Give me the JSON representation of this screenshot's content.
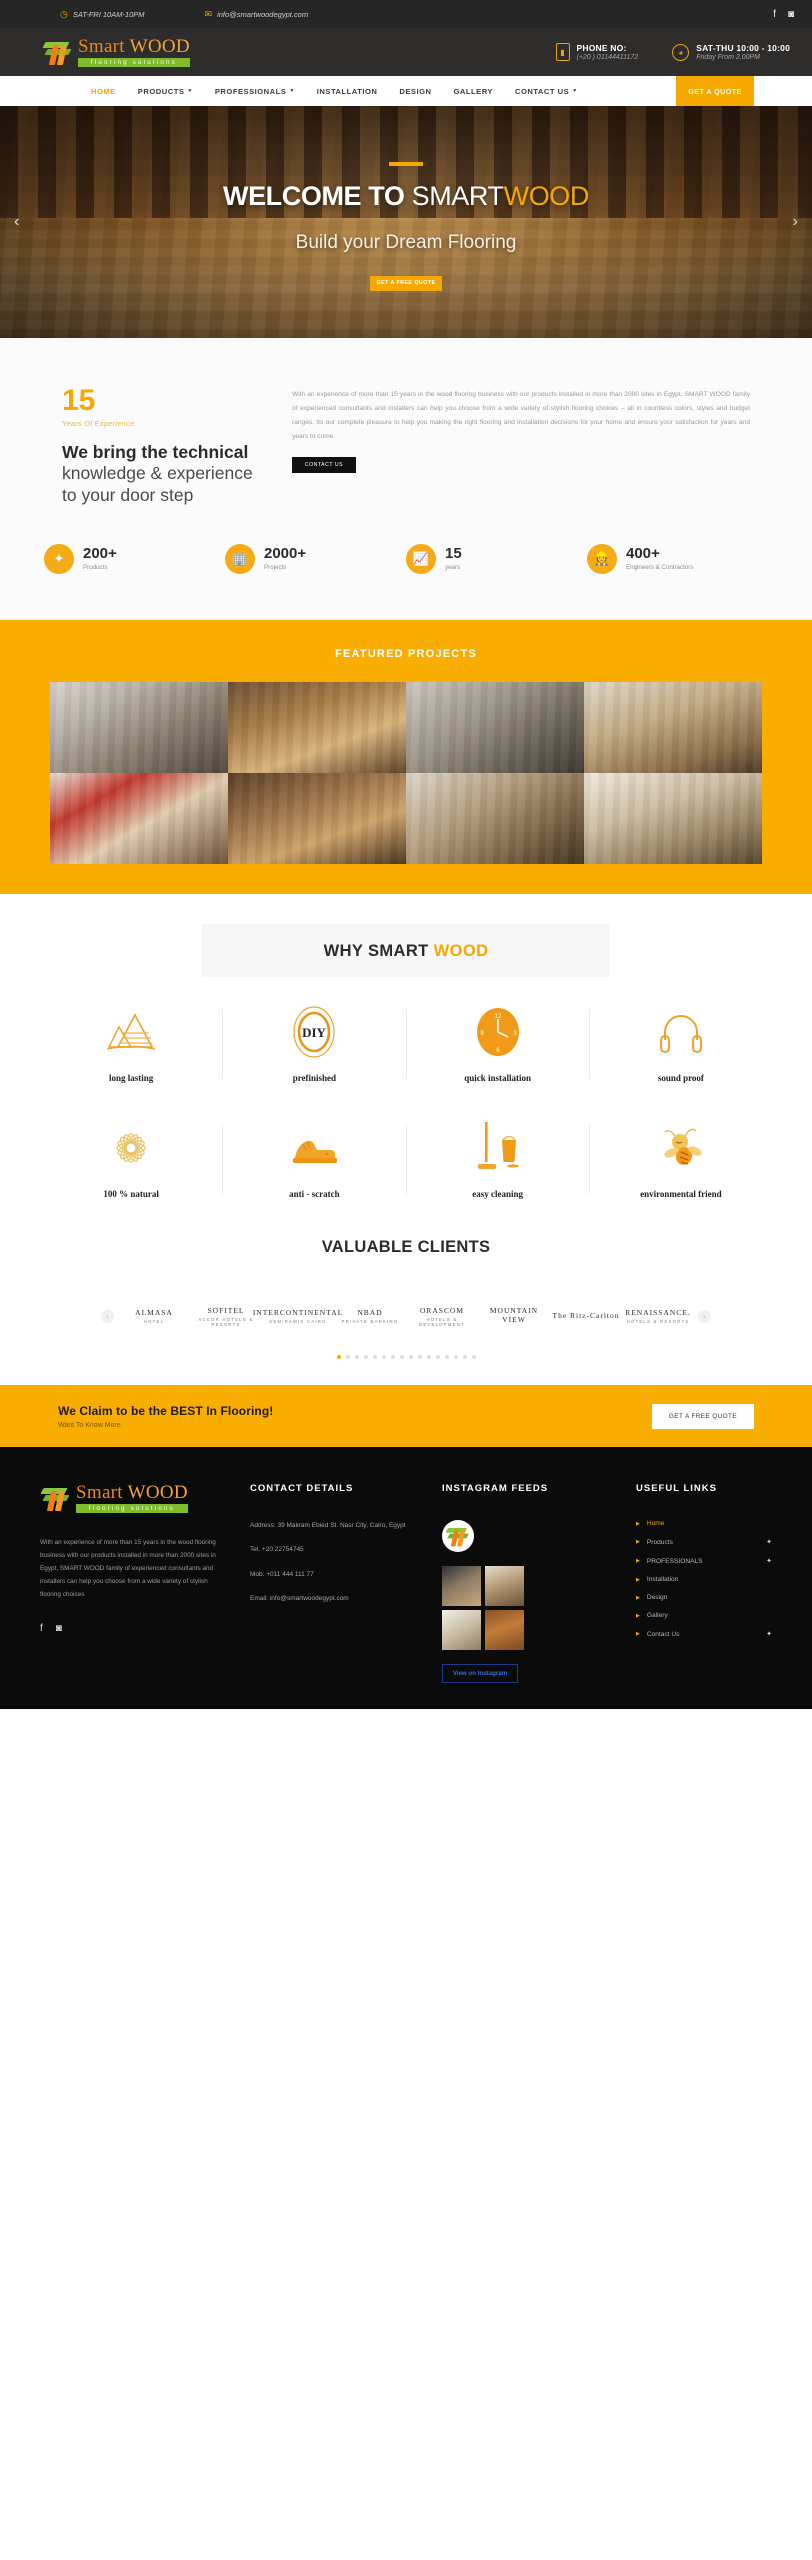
{
  "topbar": {
    "hours": "SAT-FRI 10AM-10PM",
    "email": "info@smartwoodegypt.com",
    "clock_icon": "clock-icon",
    "mail_icon": "mail-icon",
    "facebook_icon": "facebook-icon",
    "instagram_icon": "instagram-icon"
  },
  "header": {
    "logo_name": "Smart ",
    "logo_name_bold": "WOOD",
    "logo_sub": "flooring solutions",
    "phone_label": "PHONE NO:",
    "phone_value": "(+20 ) 01144411172",
    "hours_label": "SAT-THU 10:00 - 10:00",
    "hours_value": "Friday From 2.00PM",
    "phone_icon": "phone-icon",
    "clock_icon": "clock-icon"
  },
  "nav": {
    "items": [
      {
        "label": "HOME",
        "has_caret": false,
        "active": true
      },
      {
        "label": "PRODUCTS",
        "has_caret": true,
        "active": false
      },
      {
        "label": "PROFESSIONALS",
        "has_caret": true,
        "active": false
      },
      {
        "label": "INSTALLATION",
        "has_caret": false,
        "active": false
      },
      {
        "label": "DESIGN",
        "has_caret": false,
        "active": false
      },
      {
        "label": "GALLERY",
        "has_caret": false,
        "active": false
      },
      {
        "label": "CONTACT US",
        "has_caret": true,
        "active": false
      }
    ],
    "cta": "GET A QUOTE"
  },
  "hero": {
    "title_bold": "WELCOME TO ",
    "title_thin": "SMART",
    "title_amber": "WOOD",
    "subtitle": "Build your Dream Flooring",
    "button": "GET A FREE QUOTE",
    "prev_icon": "chevron-left-icon",
    "next_icon": "chevron-right-icon"
  },
  "about": {
    "years_number": "15",
    "years_label": "Years Of Experience",
    "heading_bold": "We bring the technical",
    "heading_light": "knowledge & experience to your door step",
    "paragraph": "With an experience of more than 15 years in the wood flooring business  with our products installed in more than 2000 sites in Egypt, SMART WOOD family of experienced consultants and installers can help you choose from a wide variety of stylish flooring choices – all in countless colors, styles and budget ranges. Its our complete pleasure to help you making the right flooring and installation decisions for your home and ensure your satisfaction for years and years to come.",
    "button": "CONTACT US",
    "stats": [
      {
        "number": "200+",
        "label": "Products",
        "icon": "products-icon",
        "glyph": "❦"
      },
      {
        "number": "2000+",
        "label": "Projects",
        "icon": "building-icon",
        "glyph": "Ἶ2"
      },
      {
        "number": "15",
        "label": "years",
        "icon": "chart-icon",
        "glyph": "◧"
      },
      {
        "number": "400+",
        "label": "Engineers & Contractors",
        "icon": "engineer-icon",
        "glyph": "☺"
      }
    ]
  },
  "featured": {
    "title": "FEATURED PROJECTS",
    "tiles": [
      {
        "name": "project-tile-1"
      },
      {
        "name": "project-tile-2"
      },
      {
        "name": "project-tile-3"
      },
      {
        "name": "project-tile-4"
      },
      {
        "name": "project-tile-5"
      },
      {
        "name": "project-tile-6"
      },
      {
        "name": "project-tile-7"
      },
      {
        "name": "project-tile-8"
      }
    ]
  },
  "why": {
    "title_dark": "WHY SMART ",
    "title_amber": "WOOD",
    "features_row1": [
      {
        "label": "long lasting",
        "icon": "pyramid-icon"
      },
      {
        "label": "prefinished",
        "icon": "diy-icon"
      },
      {
        "label": "quick installation",
        "icon": "clock-icon"
      },
      {
        "label": "sound proof",
        "icon": "headphones-icon"
      }
    ],
    "features_row2": [
      {
        "label": "100 % natural",
        "icon": "flower-icon"
      },
      {
        "label": "anti - scratch",
        "icon": "shoe-icon"
      },
      {
        "label": "easy cleaning",
        "icon": "mop-bucket-icon"
      },
      {
        "label": "environmental friend",
        "icon": "bee-icon"
      }
    ]
  },
  "clients": {
    "title": "VALUABLE CLIENTS",
    "logos": [
      {
        "name": "ALMASA",
        "sub": "HOTEL"
      },
      {
        "name": "SOFITEL",
        "sub": "ACCOR HOTELS & RESORTS"
      },
      {
        "name": "INTERCONTINENTAL",
        "sub": "SEMIRAMIS CAIRO"
      },
      {
        "name": "NBAD",
        "sub": "PRIVATE BANKING"
      },
      {
        "name": "ORASCOM",
        "sub": "HOTELS & DEVELOPMENT"
      },
      {
        "name": "MOUNTAIN VIEW",
        "sub": ""
      },
      {
        "name": "The Ritz-Carlton",
        "sub": ""
      },
      {
        "name": "RENAISSANCE.",
        "sub": "HOTELS & RESORTS"
      }
    ],
    "dots_count": 16,
    "active_dot": 0,
    "prev_icon": "chevron-left-icon",
    "next_icon": "chevron-right-icon"
  },
  "cta": {
    "heading": "We Claim to be the BEST In Flooring!",
    "sub": "Want To Know More.",
    "button": "GET A FREE QUOTE"
  },
  "footer": {
    "logo_name": "Smart ",
    "logo_name_bold": "WOOD",
    "logo_sub": "flooring solutions",
    "about_text": "With an experience of more than 15 years in the wood flooring business with our products installed in more than 2000 sites in Egypt, SMART WOOD family of experienced consultants and installers can help you choose from a wide variety of stylish flooring choices",
    "facebook_icon": "facebook-icon",
    "instagram_icon": "instagram-icon",
    "contact_title": "CONTACT DETAILS",
    "address": "Address: 39 Makram Ebied St. Nasr City, Cairo, Egypt",
    "tel": "Tel. +20 22754745",
    "mob": "Mob. +011 444 111 77",
    "email": "Email: info@smartwoodegypt.com",
    "instagram_title": "INSTAGRAM FEEDS",
    "instagram_button": "View on Instagram",
    "links_title": "USEFUL LINKS",
    "links": [
      {
        "label": "Home",
        "plus": false,
        "active": true
      },
      {
        "label": "Products",
        "plus": true,
        "active": false
      },
      {
        "label": "PROFESSIONALS",
        "plus": true,
        "active": false
      },
      {
        "label": "Installation",
        "plus": false,
        "active": false
      },
      {
        "label": "Design",
        "plus": false,
        "active": false
      },
      {
        "label": "Gallery",
        "plus": false,
        "active": false
      },
      {
        "label": "Contact Us",
        "plus": true,
        "active": false
      }
    ]
  },
  "colors": {
    "accent": "#f5a800",
    "banner": "#f9ad00",
    "dark": "#262626",
    "footer_bg": "#0b0b0b"
  }
}
